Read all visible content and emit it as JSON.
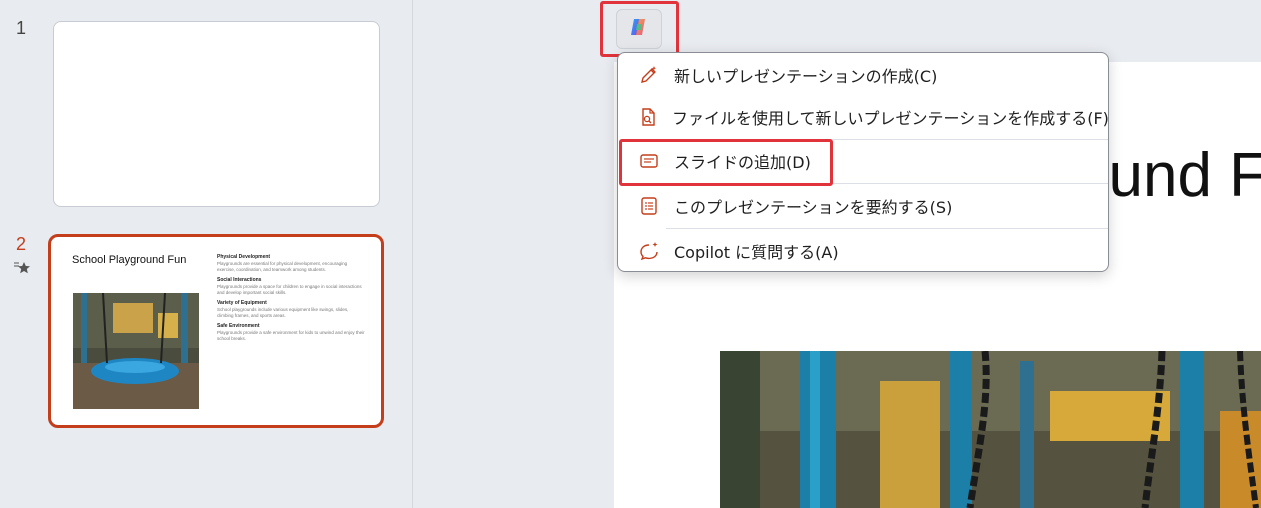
{
  "thumbnails": [
    {
      "number": "1"
    },
    {
      "number": "2",
      "title": "School Playground Fun",
      "sections": [
        {
          "heading": "Physical Development",
          "body": "Playgrounds are essential for physical development, encouraging exercise, coordination, and teamwork among students."
        },
        {
          "heading": "Social Interactions",
          "body": "Playgrounds provide a space for children to engage in social interactions and develop important social skills."
        },
        {
          "heading": "Variety of Equipment",
          "body": "School playgrounds include various equipment like swings, slides, climbing frames, and sports areas."
        },
        {
          "heading": "Safe Environment",
          "body": "Playgrounds provide a safe environment for kids to unwind and enjoy their school breaks."
        }
      ]
    }
  ],
  "slide": {
    "title_visible": "ound F"
  },
  "menu": {
    "items": [
      {
        "label": "新しいプレゼンテーションの作成(C)",
        "icon": "pen-sparkle-icon"
      },
      {
        "label": "ファイルを使用して新しいプレゼンテーションを作成する(F)",
        "icon": "document-search-icon"
      },
      {
        "label": "スライドの追加(D)",
        "icon": "slide-add-icon"
      },
      {
        "label": "このプレゼンテーションを要約する(S)",
        "icon": "list-summary-icon"
      },
      {
        "label": "Copilot に質問する(A)",
        "icon": "chat-sparkle-icon"
      }
    ]
  },
  "colors": {
    "accent": "#c43e1c",
    "highlight": "#e0333b"
  }
}
